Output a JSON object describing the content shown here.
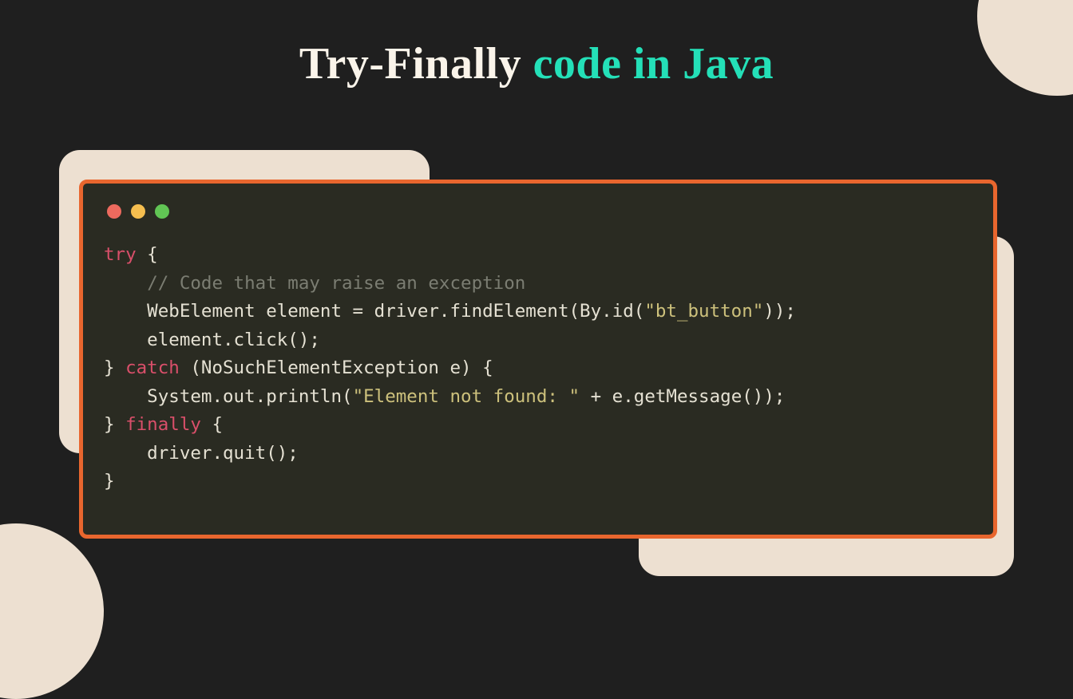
{
  "title": {
    "part1": "Try-Finally ",
    "part2": "code in Java"
  },
  "code": {
    "lines": [
      {
        "segments": [
          {
            "t": "try",
            "cls": "k"
          },
          {
            "t": " {",
            "cls": ""
          }
        ]
      },
      {
        "segments": [
          {
            "t": "    ",
            "cls": ""
          },
          {
            "t": "// Code that may raise an exception",
            "cls": "c"
          }
        ]
      },
      {
        "segments": [
          {
            "t": "    WebElement element = driver.findElement(By.id(",
            "cls": ""
          },
          {
            "t": "\"bt_button\"",
            "cls": "s"
          },
          {
            "t": "));",
            "cls": ""
          }
        ]
      },
      {
        "segments": [
          {
            "t": "    element.click();",
            "cls": ""
          }
        ]
      },
      {
        "segments": [
          {
            "t": "} ",
            "cls": ""
          },
          {
            "t": "catch",
            "cls": "k"
          },
          {
            "t": " (NoSuchElementException e) {",
            "cls": ""
          }
        ]
      },
      {
        "segments": [
          {
            "t": "    System.out.println(",
            "cls": ""
          },
          {
            "t": "\"Element not found: \"",
            "cls": "s"
          },
          {
            "t": " + e.getMessage());",
            "cls": ""
          }
        ]
      },
      {
        "segments": [
          {
            "t": "} ",
            "cls": ""
          },
          {
            "t": "finally",
            "cls": "k"
          },
          {
            "t": " {",
            "cls": ""
          }
        ]
      },
      {
        "segments": [
          {
            "t": "    driver.quit();",
            "cls": ""
          }
        ]
      },
      {
        "segments": [
          {
            "t": "}",
            "cls": ""
          }
        ]
      }
    ]
  },
  "traffic_colors": {
    "red": "#ed6a5e",
    "yellow": "#f5be4f",
    "green": "#61c554"
  }
}
